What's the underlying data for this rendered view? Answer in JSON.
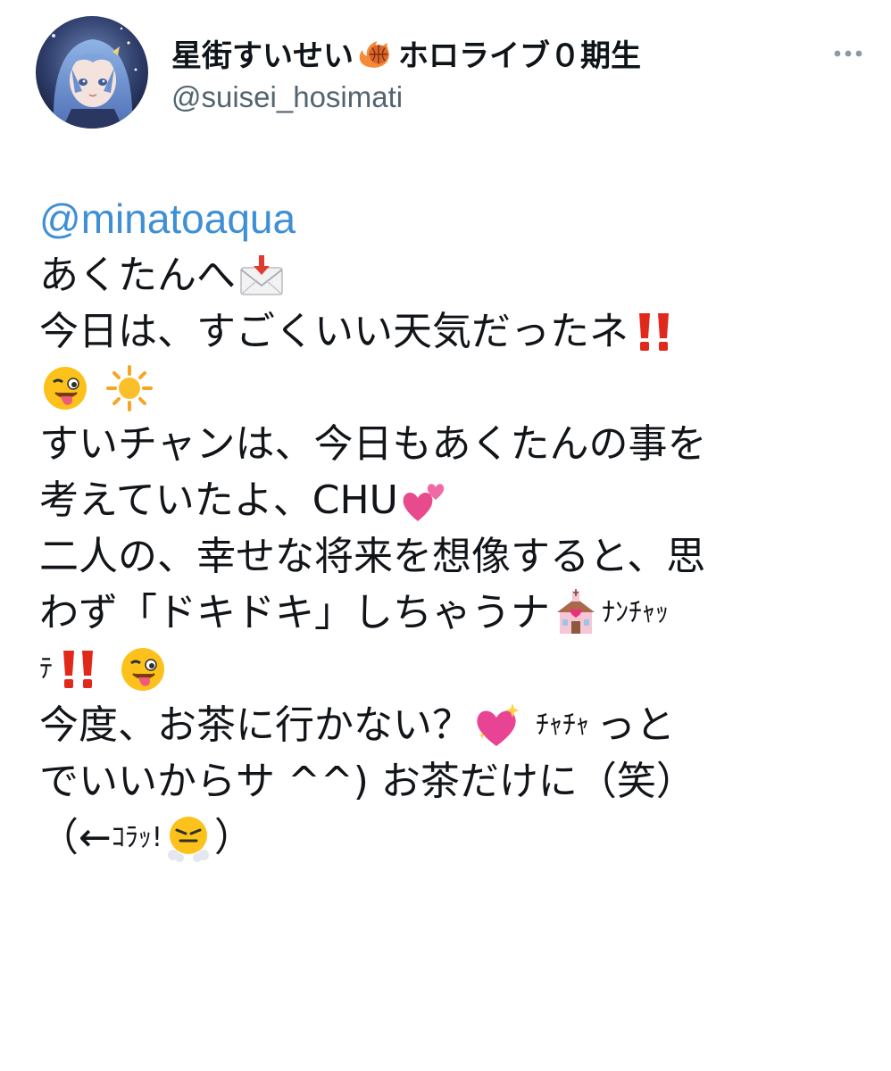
{
  "author": {
    "display_name": "星街すいせい",
    "display_name_suffix": "ホロライブ０期生",
    "handle": "@suisei_hosimati",
    "avatar_icon": "avatar-image",
    "more_icon": "more-horizontal-icon"
  },
  "tweet": {
    "mention": "@minatoaqua",
    "line1": "あくたんへ",
    "line2": "今日は、すごくいい天気だったネ",
    "line4": "すいチャンは、今日もあくたんの事を",
    "line5": "考えていたよ、CHU",
    "line6": "二人の、幸せな将来を想像すると、思",
    "line7": "わず「ドキドキ」しちゃうナ",
    "line7_small": "ﾅﾝﾁｬｯ",
    "line8_small": "ﾃ",
    "line9a": "今度、お茶に行かない？",
    "line9b": "ﾁｬﾁｬ",
    "line9c": "っと",
    "line10": "でいいからサ ^^) お茶だけに（笑）",
    "line11a": "（←",
    "line11b": "ｺﾗｯ!",
    "line11c": "）"
  },
  "colors": {
    "mention": "#3f8fd5",
    "handle": "#536471",
    "text": "#111418"
  },
  "emoji": [
    "envelope-with-arrow-icon",
    "double-exclamation-icon",
    "winking-tongue-face-icon",
    "sun-icon",
    "two-hearts-icon",
    "wedding-chapel-icon",
    "sparkling-heart-icon",
    "face-with-steam-icon",
    "fire-basketball-icon"
  ]
}
